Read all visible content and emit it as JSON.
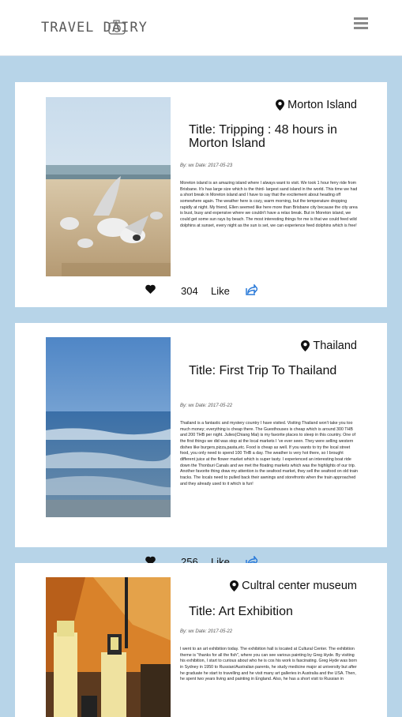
{
  "header": {
    "brand": "TRAVEL DAIRY",
    "menu_icon": "hamburger-menu-icon"
  },
  "posts": [
    {
      "location": "Morton Island",
      "title": "Title: Tripping : 48 hours in Morton Island",
      "meta": "By:  wx   Date:  2017-05-23",
      "body": "Moreton island is an amazing island where I always want to visit. We took 1 hour ferry ride from Brisbane. It's has large size which is the third- largest sand island in the world. This time we had a short break in Moreton island and I have to say that the excitement about heading off somewhere again. The weather here is cozy, warm morning, but the temperature dropping rapidly at night. My friend, Ellen seemed like here more than Brisbane city because the city area is bust, busy and expensive where we couldn't have a relax break. But in Moreton island, we could get some sun rays by beach. The most interesting things for me is that we could feed wild dolphins at sunset, every night as the sun is set, we can experience feed dolphins which is free!",
      "likes": "304",
      "like_label": "Like"
    },
    {
      "location": "Thailand",
      "title": "Title: First Trip To Thailand",
      "meta": "By:  wx   Date:  2017-05-22",
      "body": "Thailand is a fantastic and mystery country I have visited. Visiting Thailand won't take you too much money; everything is cheap there. The Guesthouses is cheap which is around 300 THB and 200 THB per night. Julies(Chiang Mai) is my favorite places to sleep in this country. One of the first things we did was stop at the local markets I 've ever seen. They were selling western dishes like burgers,pizza,pasta,etc. Food is cheap as well. If you wants to try the local street food, you only need to spend 100 THB a day. The weather is very hot there, so I brought different juice at the flower market which is super tasty. I experienced an interesting boat ride down the Thonburi Canals and we met the floating markets which was the highlights of our trip. Another favorite thing draw my attention is the seafood market, they sell the seafood on old train tracks. The locals need to pulled back their awnings and storefronts when the train approached and they already used to it which is fun!",
      "likes": "256",
      "like_label": "Like"
    },
    {
      "location": "Cultral center museum",
      "title": "Title: Art Exhibition",
      "meta": "By:  wx   Date:  2017-05-22",
      "body": "I went to an art exhibition today. The exhibition hall is located at Cultural Center. The exhibition theme is \"thanks for all the fish\", where you can see various painting by Greg Hyde. By visiting his exhibition, I start to curious about who he is cos his work is fascinating. Greg Hyde was born in Sydney in 1950 to Russian/Australian parents, he study medicine major at university but after he graduate he start to travelling and he visit many art galleries in Australia and the USA. Then, he spent two years living and painting in England. Also, he has a short visit to Russian in",
      "likes": "",
      "like_label": ""
    }
  ]
}
